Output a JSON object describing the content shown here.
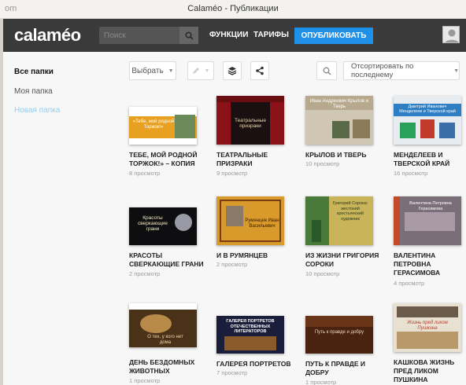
{
  "window": {
    "url_fragment": "om",
    "title": "Calaméo - Публикации"
  },
  "header": {
    "logo": "calaméo",
    "search_placeholder": "Поиск",
    "nav": [
      "ФУНКЦИИ",
      "ТАРИФЫ"
    ],
    "publish_label": "ОПУБЛИКОВАТЬ"
  },
  "sidebar": {
    "items": [
      {
        "label": "Все папки",
        "active": true
      },
      {
        "label": "Моя папка",
        "active": false
      },
      {
        "label": "Новая папка",
        "active": false
      }
    ]
  },
  "toolbar": {
    "select_label": "Выбрать",
    "sort_label": "Отсортировать по последнему"
  },
  "colors": {
    "accent": "#1e90e8",
    "header_bg": "#3a3a3a",
    "new_folder": "#8fd0ee"
  },
  "publications": [
    {
      "title": "ТЕБЕ, МОЙ РОДНОЙ ТОРЖОК!» – КОПИЯ",
      "views": "8 просмотр",
      "cover_text": "«Тебе, мой родной Торжок!»"
    },
    {
      "title": "ТЕАТРАЛЬНЫЕ ПРИЗРАКИ",
      "views": "9 просмотр",
      "cover_text": "Театральные призраки"
    },
    {
      "title": "КРЫЛОВ И ТВЕРЬ",
      "views": "10 просмотр",
      "cover_text": "Иван Андреевич Крылов и Тверь"
    },
    {
      "title": "МЕНДЕЛЕЕВ И ТВЕРСКОЙ КРАЙ",
      "views": "16 просмотр",
      "cover_text": "Дмитрий Иванович Менделеев и Тверской край"
    },
    {
      "title": "КРАСОТЫ СВЕРКАЮЩИЕ ГРАНИ",
      "views": "2 просмотр",
      "cover_text": "Красоты сверкающие грани"
    },
    {
      "title": "И В РУМЯНЦЕВ",
      "views": "2 просмотр",
      "cover_text": "Румянцев Иван Васильевич"
    },
    {
      "title": "ИЗ ЖИЗНИ ГРИГОРИЯ СОРОКИ",
      "views": "10 просмотр",
      "cover_text": "Григорий Сорока: жестокий крестьянский художник"
    },
    {
      "title": "ВАЛЕНТИНА ПЕТРОВНА ГЕРАСИМОВА",
      "views": "4 просмотр",
      "cover_text": "Валентина Петровна Герасимова"
    },
    {
      "title": "ДЕНЬ БЕЗДОМНЫХ ЖИВОТНЫХ",
      "views": "1 просмотр",
      "cover_text": "О тех, у кого нет дома"
    },
    {
      "title": "ГАЛЕРЕЯ ПОРТРЕТОВ",
      "views": "7 просмотр",
      "cover_text": "ГАЛЕРЕЯ ПОРТРЕТОВ ОТЕЧЕСТВЕННЫХ ЛИТЕРАТОРОВ"
    },
    {
      "title": "ПУТЬ К ПРАВДЕ И ДОБРУ",
      "views": "1 просмотр",
      "cover_text": "Путь к правде и добру"
    },
    {
      "title": "КАШКОВА ЖИЗНЬ ПРЕД ЛИКОМ ПУШКИНА",
      "views": "",
      "cover_text": "Жизнь пред ликом Пушкина"
    }
  ]
}
